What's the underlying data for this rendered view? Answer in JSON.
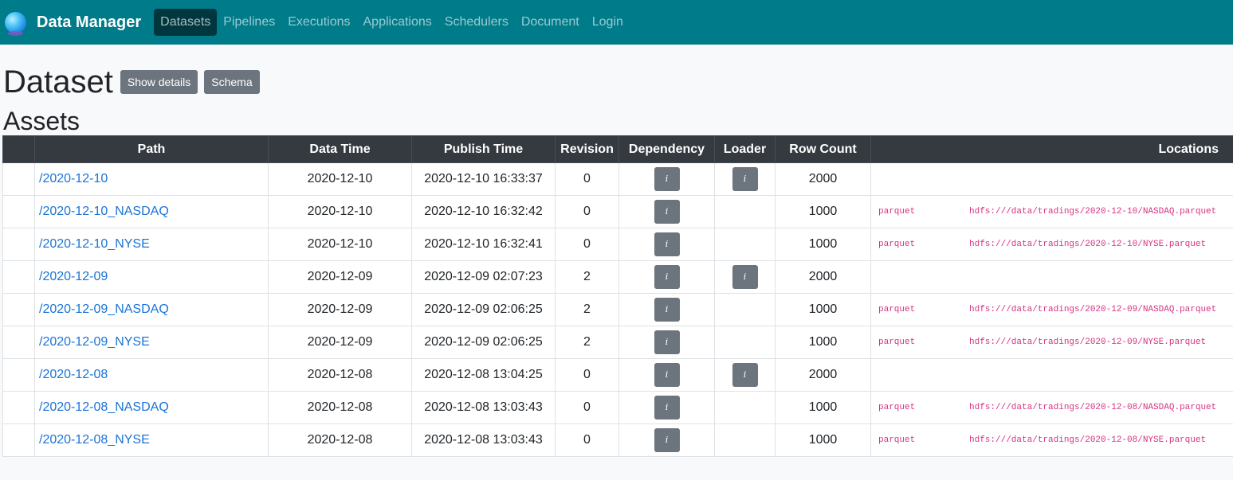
{
  "nav": {
    "brand": "Data Manager",
    "links": [
      "Datasets",
      "Pipelines",
      "Executions",
      "Applications",
      "Schedulers",
      "Document",
      "Login"
    ]
  },
  "page": {
    "title": "Dataset",
    "show_details": "Show details",
    "schema": "Schema",
    "assets_title": "Assets"
  },
  "table": {
    "headers": [
      "",
      "Path",
      "Data Time",
      "Publish Time",
      "Revision",
      "Dependency",
      "Loader",
      "Row Count",
      "Locations"
    ],
    "info_icon": "i",
    "rows": [
      {
        "path": "/2020-12-10",
        "data_time": "2020-12-10",
        "publish_time": "2020-12-10 16:33:37",
        "revision": "0",
        "dependency": true,
        "loader": true,
        "row_count": "2000",
        "loc_type": "",
        "loc_path": ""
      },
      {
        "path": "/2020-12-10_NASDAQ",
        "data_time": "2020-12-10",
        "publish_time": "2020-12-10 16:32:42",
        "revision": "0",
        "dependency": true,
        "loader": false,
        "row_count": "1000",
        "loc_type": "parquet",
        "loc_path": "hdfs:///data/tradings/2020-12-10/NASDAQ.parquet"
      },
      {
        "path": "/2020-12-10_NYSE",
        "data_time": "2020-12-10",
        "publish_time": "2020-12-10 16:32:41",
        "revision": "0",
        "dependency": true,
        "loader": false,
        "row_count": "1000",
        "loc_type": "parquet",
        "loc_path": "hdfs:///data/tradings/2020-12-10/NYSE.parquet"
      },
      {
        "path": "/2020-12-09",
        "data_time": "2020-12-09",
        "publish_time": "2020-12-09 02:07:23",
        "revision": "2",
        "dependency": true,
        "loader": true,
        "row_count": "2000",
        "loc_type": "",
        "loc_path": ""
      },
      {
        "path": "/2020-12-09_NASDAQ",
        "data_time": "2020-12-09",
        "publish_time": "2020-12-09 02:06:25",
        "revision": "2",
        "dependency": true,
        "loader": false,
        "row_count": "1000",
        "loc_type": "parquet",
        "loc_path": "hdfs:///data/tradings/2020-12-09/NASDAQ.parquet"
      },
      {
        "path": "/2020-12-09_NYSE",
        "data_time": "2020-12-09",
        "publish_time": "2020-12-09 02:06:25",
        "revision": "2",
        "dependency": true,
        "loader": false,
        "row_count": "1000",
        "loc_type": "parquet",
        "loc_path": "hdfs:///data/tradings/2020-12-09/NYSE.parquet"
      },
      {
        "path": "/2020-12-08",
        "data_time": "2020-12-08",
        "publish_time": "2020-12-08 13:04:25",
        "revision": "0",
        "dependency": true,
        "loader": true,
        "row_count": "2000",
        "loc_type": "",
        "loc_path": ""
      },
      {
        "path": "/2020-12-08_NASDAQ",
        "data_time": "2020-12-08",
        "publish_time": "2020-12-08 13:03:43",
        "revision": "0",
        "dependency": true,
        "loader": false,
        "row_count": "1000",
        "loc_type": "parquet",
        "loc_path": "hdfs:///data/tradings/2020-12-08/NASDAQ.parquet"
      },
      {
        "path": "/2020-12-08_NYSE",
        "data_time": "2020-12-08",
        "publish_time": "2020-12-08 13:03:43",
        "revision": "0",
        "dependency": true,
        "loader": false,
        "row_count": "1000",
        "loc_type": "parquet",
        "loc_path": "hdfs:///data/tradings/2020-12-08/NYSE.parquet"
      }
    ]
  },
  "colors": {
    "navbar": "#007b8a",
    "table_header": "#343a40",
    "link": "#1a73d6",
    "code": "#d63384",
    "button": "#6c757d"
  }
}
